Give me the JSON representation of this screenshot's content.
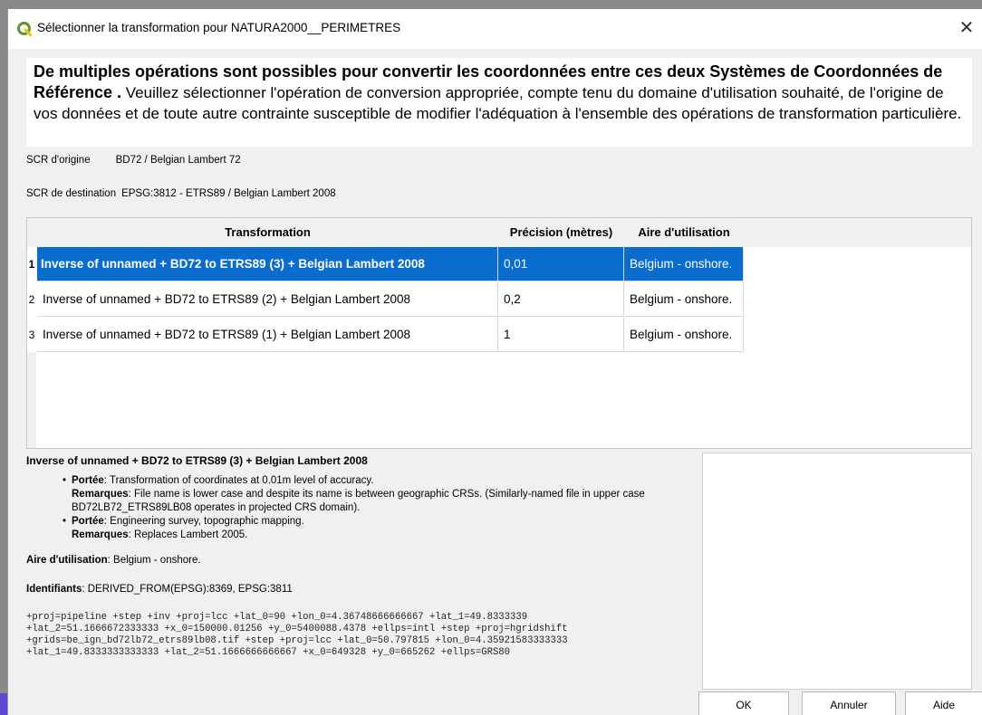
{
  "window": {
    "title": "Sélectionner la transformation pour NATURA2000__PERIMETRES",
    "close_glyph": "✕",
    "icon": "qgis-logo-icon"
  },
  "header": {
    "bold_text": "De multiples opérations sont possibles pour convertir les coordonnées entre ces deux Systèmes de Coordonnées de Référence .",
    "normal_text": " Veuillez sélectionner l'opération de conversion appropriée, compte tenu du domaine d'utilisation souhaité, de l'origine de vos données et de toute autre contrainte susceptible de modifier l'adéquation à l'ensemble des opérations de transformation particulière."
  },
  "source_crs": {
    "label": "SCR d'origine",
    "value": "BD72 / Belgian Lambert 72"
  },
  "dest_crs": {
    "label": "SCR de destination",
    "value": "EPSG:3812 - ETRS89 / Belgian Lambert 2008"
  },
  "table": {
    "columns": [
      "Transformation",
      "Précision (mètres)",
      "Aire d'utilisation"
    ],
    "rows": [
      {
        "num": "1",
        "transformation": "Inverse of unnamed + BD72 to ETRS89 (3) + Belgian Lambert 2008",
        "precision": "0,01",
        "area": "Belgium - onshore.",
        "selected": true
      },
      {
        "num": "2",
        "transformation": "Inverse of unnamed + BD72 to ETRS89 (2) + Belgian Lambert 2008",
        "precision": "0,2",
        "area": "Belgium - onshore.",
        "selected": false
      },
      {
        "num": "3",
        "transformation": "Inverse of unnamed + BD72 to ETRS89 (1) + Belgian Lambert 2008",
        "precision": "1",
        "area": "Belgium - onshore.",
        "selected": false
      }
    ]
  },
  "details": {
    "title": "Inverse of unnamed + BD72 to ETRS89 (3) + Belgian Lambert 2008",
    "items": [
      {
        "scope_label": "Portée",
        "scope": ": Transformation of coordinates at 0.01m level of accuracy.",
        "remarks_label": "Remarques",
        "remarks": ": File name is lower case and despite its name is between geographic CRSs. (Similarly-named file in upper case BD72LB72_ETRS89LB08 operates in projected CRS domain)."
      },
      {
        "scope_label": "Portée",
        "scope": ": Engineering survey, topographic mapping.",
        "remarks_label": "Remarques",
        "remarks": ": Replaces Lambert 2005."
      }
    ],
    "area_label": "Aire d'utilisation",
    "area_value": ": Belgium - onshore.",
    "ids_label": "Identifiants",
    "ids_value": ": DERIVED_FROM(EPSG):8369, EPSG:3811",
    "proj_lines": [
      "+proj=pipeline +step +inv +proj=lcc +lat_0=90 +lon_0=4.36748666666667 +lat_1=49.8333339",
      "+lat_2=51.1666672333333 +x_0=150000.01256 +y_0=5400088.4378 +ellps=intl +step +proj=hgridshift",
      "+grids=be_ign_bd72lb72_etrs89lb08.tif +step +proj=lcc +lat_0=50.797815 +lon_0=4.35921583333333",
      "+lat_1=49.8333333333333 +lat_2=51.1666666666667 +x_0=649328 +y_0=665262 +ellps=GRS80"
    ]
  },
  "buttons": {
    "ok": "OK",
    "cancel": "Annuler",
    "help": "Aide"
  },
  "colors": {
    "selection": "#0a6ccd",
    "qgis_green": "#589632"
  }
}
